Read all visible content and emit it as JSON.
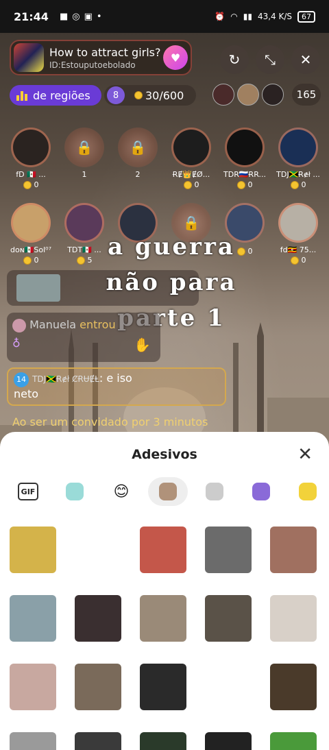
{
  "status_bar": {
    "time": "21:44",
    "network_speed": "43,4 K/S",
    "battery": "67"
  },
  "room": {
    "title": "How to attract girls?",
    "id": "ID:Estouputoebolado",
    "region_label": "de regiões",
    "level_badge": "8",
    "coins": "30/600",
    "viewer_count": "165"
  },
  "seats_row1": [
    {
      "name": "fD 🇲🇽 ...",
      "coins": "0",
      "type": "avatar",
      "color": "#2a2320"
    },
    {
      "name": "1",
      "coins": "",
      "type": "locked",
      "color": ""
    },
    {
      "name": "2",
      "coins": "",
      "type": "locked",
      "color": ""
    },
    {
      "name": "ɌɆ👑ɆØ...",
      "coins": "0",
      "type": "avatar",
      "color": "#1d1d1d"
    },
    {
      "name": "TDR🇷🇺ɌR...",
      "coins": "0",
      "type": "avatar",
      "color": "#111111"
    },
    {
      "name": "TDJ🇯🇲Ɍɇł ...",
      "coins": "0",
      "type": "avatar",
      "color": "#1a2f55"
    }
  ],
  "seats_row2": [
    {
      "name": "dᴏɴ🇲🇽Sol⁰⁷",
      "coins": "0",
      "type": "avatar",
      "color": "#c8a06a"
    },
    {
      "name": "TDT🇲🇽 ...",
      "coins": "5",
      "type": "avatar",
      "color": "#5a3a5a"
    },
    {
      "name": "",
      "coins": "",
      "type": "avatar",
      "color": "#2b3140"
    },
    {
      "name": "",
      "coins": "",
      "type": "locked",
      "color": ""
    },
    {
      "name": "",
      "coins": "0",
      "type": "avatar",
      "color": "#3a4a6a"
    },
    {
      "name": "fd🇺🇬 75...",
      "coins": "0",
      "type": "avatar",
      "color": "#b7b0a5"
    }
  ],
  "overlay_text": {
    "line1": "a guerra",
    "line2": "não para",
    "line3": "parte 1"
  },
  "chat": {
    "join_user": "Manuela",
    "join_action": "entrou",
    "msg_level": "14",
    "msg_user": "TDJ🇯🇲Ɍɇł ȻɌɄɆⱠ",
    "msg_text_a": ": e iso",
    "msg_text_b": "neto",
    "guest_note": "Ao ser um convidado por 3 minutos"
  },
  "stickers_panel": {
    "title": "Adesivos",
    "tabs": [
      {
        "label": "GIF",
        "icon": "gif-icon"
      },
      {
        "label": "",
        "icon": "bunny-sticker-icon"
      },
      {
        "label": "😊",
        "icon": "smile-emoji-icon"
      },
      {
        "label": "",
        "icon": "photo-sticker-icon"
      },
      {
        "label": "",
        "icon": "cat-sticker-icon"
      },
      {
        "label": "",
        "icon": "purple-cat-icon"
      },
      {
        "label": "",
        "icon": "duck-icon"
      }
    ],
    "sticker_colors": [
      "#d4b34a",
      "#ffffff",
      "#c4574a",
      "#6b6b6b",
      "#a07060",
      "#8aa0a8",
      "#3a2f30",
      "#9a8a78",
      "#5a5248",
      "#d8d0c8",
      "#c8a8a0",
      "#7a6a5a",
      "#2a2a2a",
      "#ffffff",
      "#4a3a2a",
      "#9a9a9a",
      "#3a3a3a",
      "#2a3a2a",
      "#222222",
      "#4a9a3a"
    ]
  }
}
